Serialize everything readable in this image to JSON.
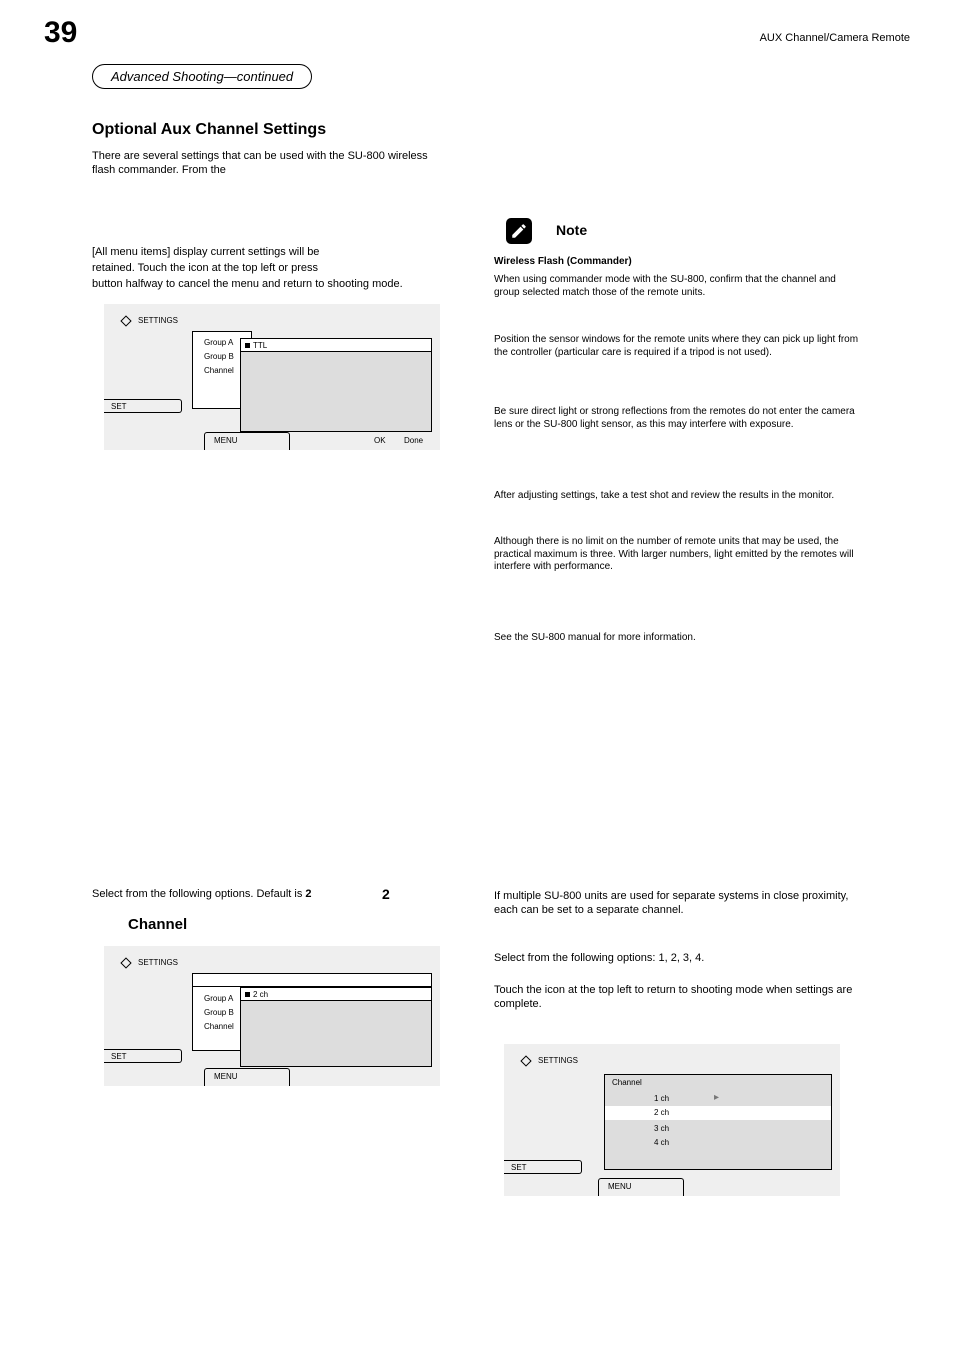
{
  "page": {
    "number": "39",
    "running_header": "AUX Channel/Camera Remote",
    "callout": "Advanced Shooting—continued"
  },
  "title": "Optional Aux Channel Settings",
  "col_left": {
    "p1": "There are several settings that can be used with the SU-800 wireless flash commander. From the ",
    "p2_line1": "[All menu items] display current settings will be",
    "p2_line2": "retained. Touch the icon at the top left or press",
    "p2_line3": " button halfway to cancel the menu and return to shooting mode.",
    "channel_heading": "Channel",
    "preface": "Select from the following options. Default is ",
    "option": "2",
    "option_label": "Channel"
  },
  "col_right": {
    "note_heading": "Wireless Flash (Commander)",
    "note_p1": "When using commander mode with the SU-800, confirm that the channel and group selected match those of the remote units.",
    "note_p2": "Position the sensor windows for the remote units where they can pick up light from the controller (particular care is required if a tripod is not used).",
    "note_p3": "Be sure direct light or strong reflections from the remotes do not enter the camera lens or the SU-800 light sensor, as this may interfere with exposure.",
    "note_p4": "After adjusting settings, take a test shot and review the results in the monitor.",
    "note_p5": "Although there is no limit on the number of remote units that may be used, the practical maximum is three. With larger numbers, light emitted by the remotes will interfere with performance.",
    "note_p6": "See the SU-800 manual for more information.",
    "ch_p1_a": "If multiple SU-800 units are used for separate systems in close proximity, each can be set to a separate channel.",
    "ch_p1_b": "Select from the following options: 1, 2, 3, 4.",
    "ch_p1_c": "Touch the icon at the top left to return to shooting mode when settings are complete."
  },
  "menuA": {
    "tab": "SETTINGS",
    "left_stub": "SET",
    "group_a": "Group A",
    "group_b": "Group B",
    "channel": "Channel",
    "item_sel": "TTL",
    "bottom_stub": "MENU",
    "bottom_right_a": "OK",
    "bottom_right_b": "Done"
  },
  "menuB": {
    "tab": "SETTINGS",
    "left_stub": "SET",
    "group_a": "Group A",
    "group_b": "Group B",
    "channel": "Channel",
    "item_sel": "2 ch",
    "bottom_stub": "MENU"
  },
  "menuC": {
    "tab": "SETTINGS",
    "left_stub": "SET",
    "heading": "Channel",
    "opt1": "1 ch",
    "opt2": "2 ch",
    "opt3": "3 ch",
    "opt4": "4 ch",
    "bottom_stub": "MENU"
  }
}
